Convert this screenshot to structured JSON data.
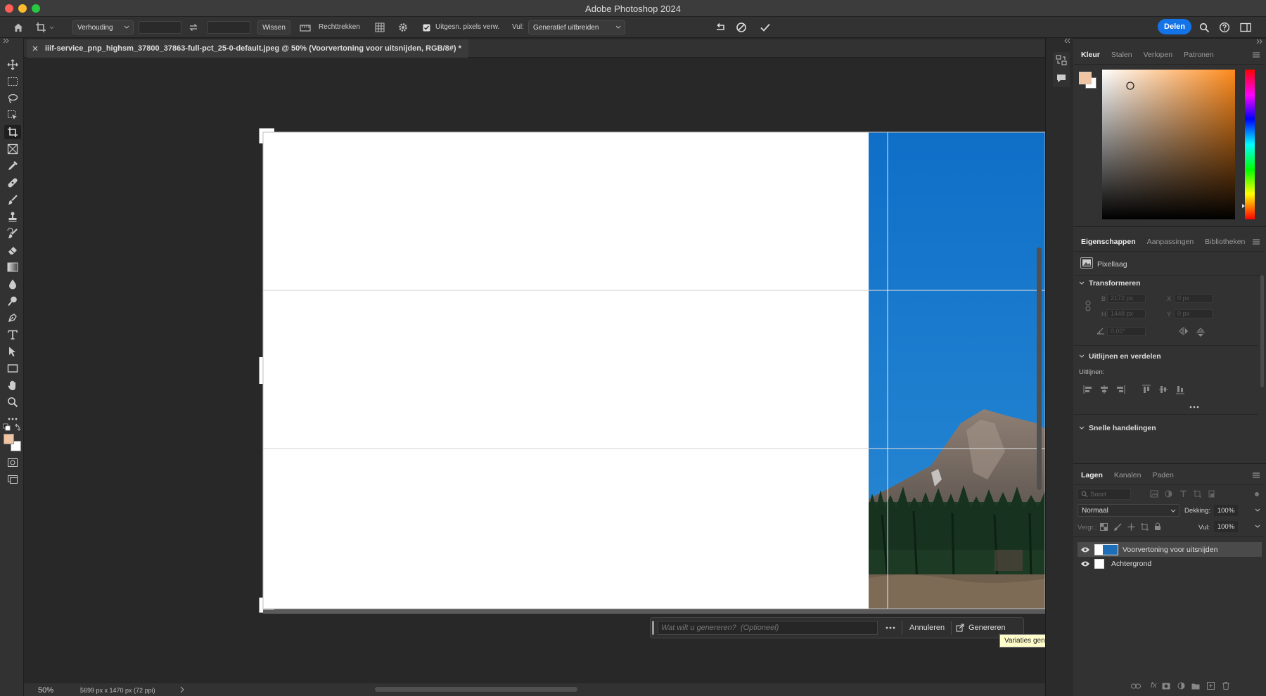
{
  "window": {
    "title": "Adobe Photoshop 2024"
  },
  "options_bar": {
    "ratio_select": "Verhouding",
    "clear_label": "Wissen",
    "straighten_label": "Rechttrekken",
    "delete_pixels_label": "Uitgesn. pixels verw.",
    "delete_pixels_checked": true,
    "fill_label": "Vul:",
    "fill_select": "Generatief uitbreiden",
    "share_label": "Delen"
  },
  "document": {
    "tab_title": "iiif-service_pnp_highsm_37800_37863-full-pct_25-0-default.jpeg @ 50% (Voorvertoning voor uitsnijden, RGB/8#) *",
    "zoom": "50%",
    "dimensions": "5699 px x 1470 px (72 ppi)"
  },
  "generate_bar": {
    "placeholder": "Wat wilt u genereren?  (Optioneel)",
    "cancel_label": "Annuleren",
    "generate_label": "Genereren",
    "tooltip": "Variaties genereren"
  },
  "color_panel": {
    "tabs": [
      "Kleur",
      "Stalen",
      "Verlopen",
      "Patronen"
    ],
    "foreground": "#f0c5a3",
    "background": "#ffffff",
    "hue": "#ff8a1a"
  },
  "properties_panel": {
    "tabs": [
      "Eigenschappen",
      "Aanpassingen",
      "Bibliotheken"
    ],
    "layer_type": "Pixellaag",
    "transform_title": "Transformeren",
    "w_label": "B",
    "w_value": "2172 px",
    "h_label": "H",
    "h_value": "1448 px",
    "x_label": "X",
    "x_value": "0 px",
    "y_label": "Y",
    "y_value": "0 px",
    "angle_value": "0,00°",
    "align_title": "Uitlijnen en verdelen",
    "align_label": "Uitlijnen:",
    "quick_actions_title": "Snelle handelingen"
  },
  "layers_panel": {
    "tabs": [
      "Lagen",
      "Kanalen",
      "Paden"
    ],
    "filter_placeholder": "Soort",
    "blend_mode": "Normaal",
    "opacity_label": "Dekking:",
    "opacity_value": "100%",
    "lock_label": "Vergr.:",
    "fill_label": "Vul:",
    "fill_value": "100%",
    "layers": [
      {
        "name": "Voorvertoning voor uitsnijden",
        "visible": true,
        "selected": true
      },
      {
        "name": "Achtergrond",
        "visible": true,
        "selected": false
      }
    ]
  }
}
